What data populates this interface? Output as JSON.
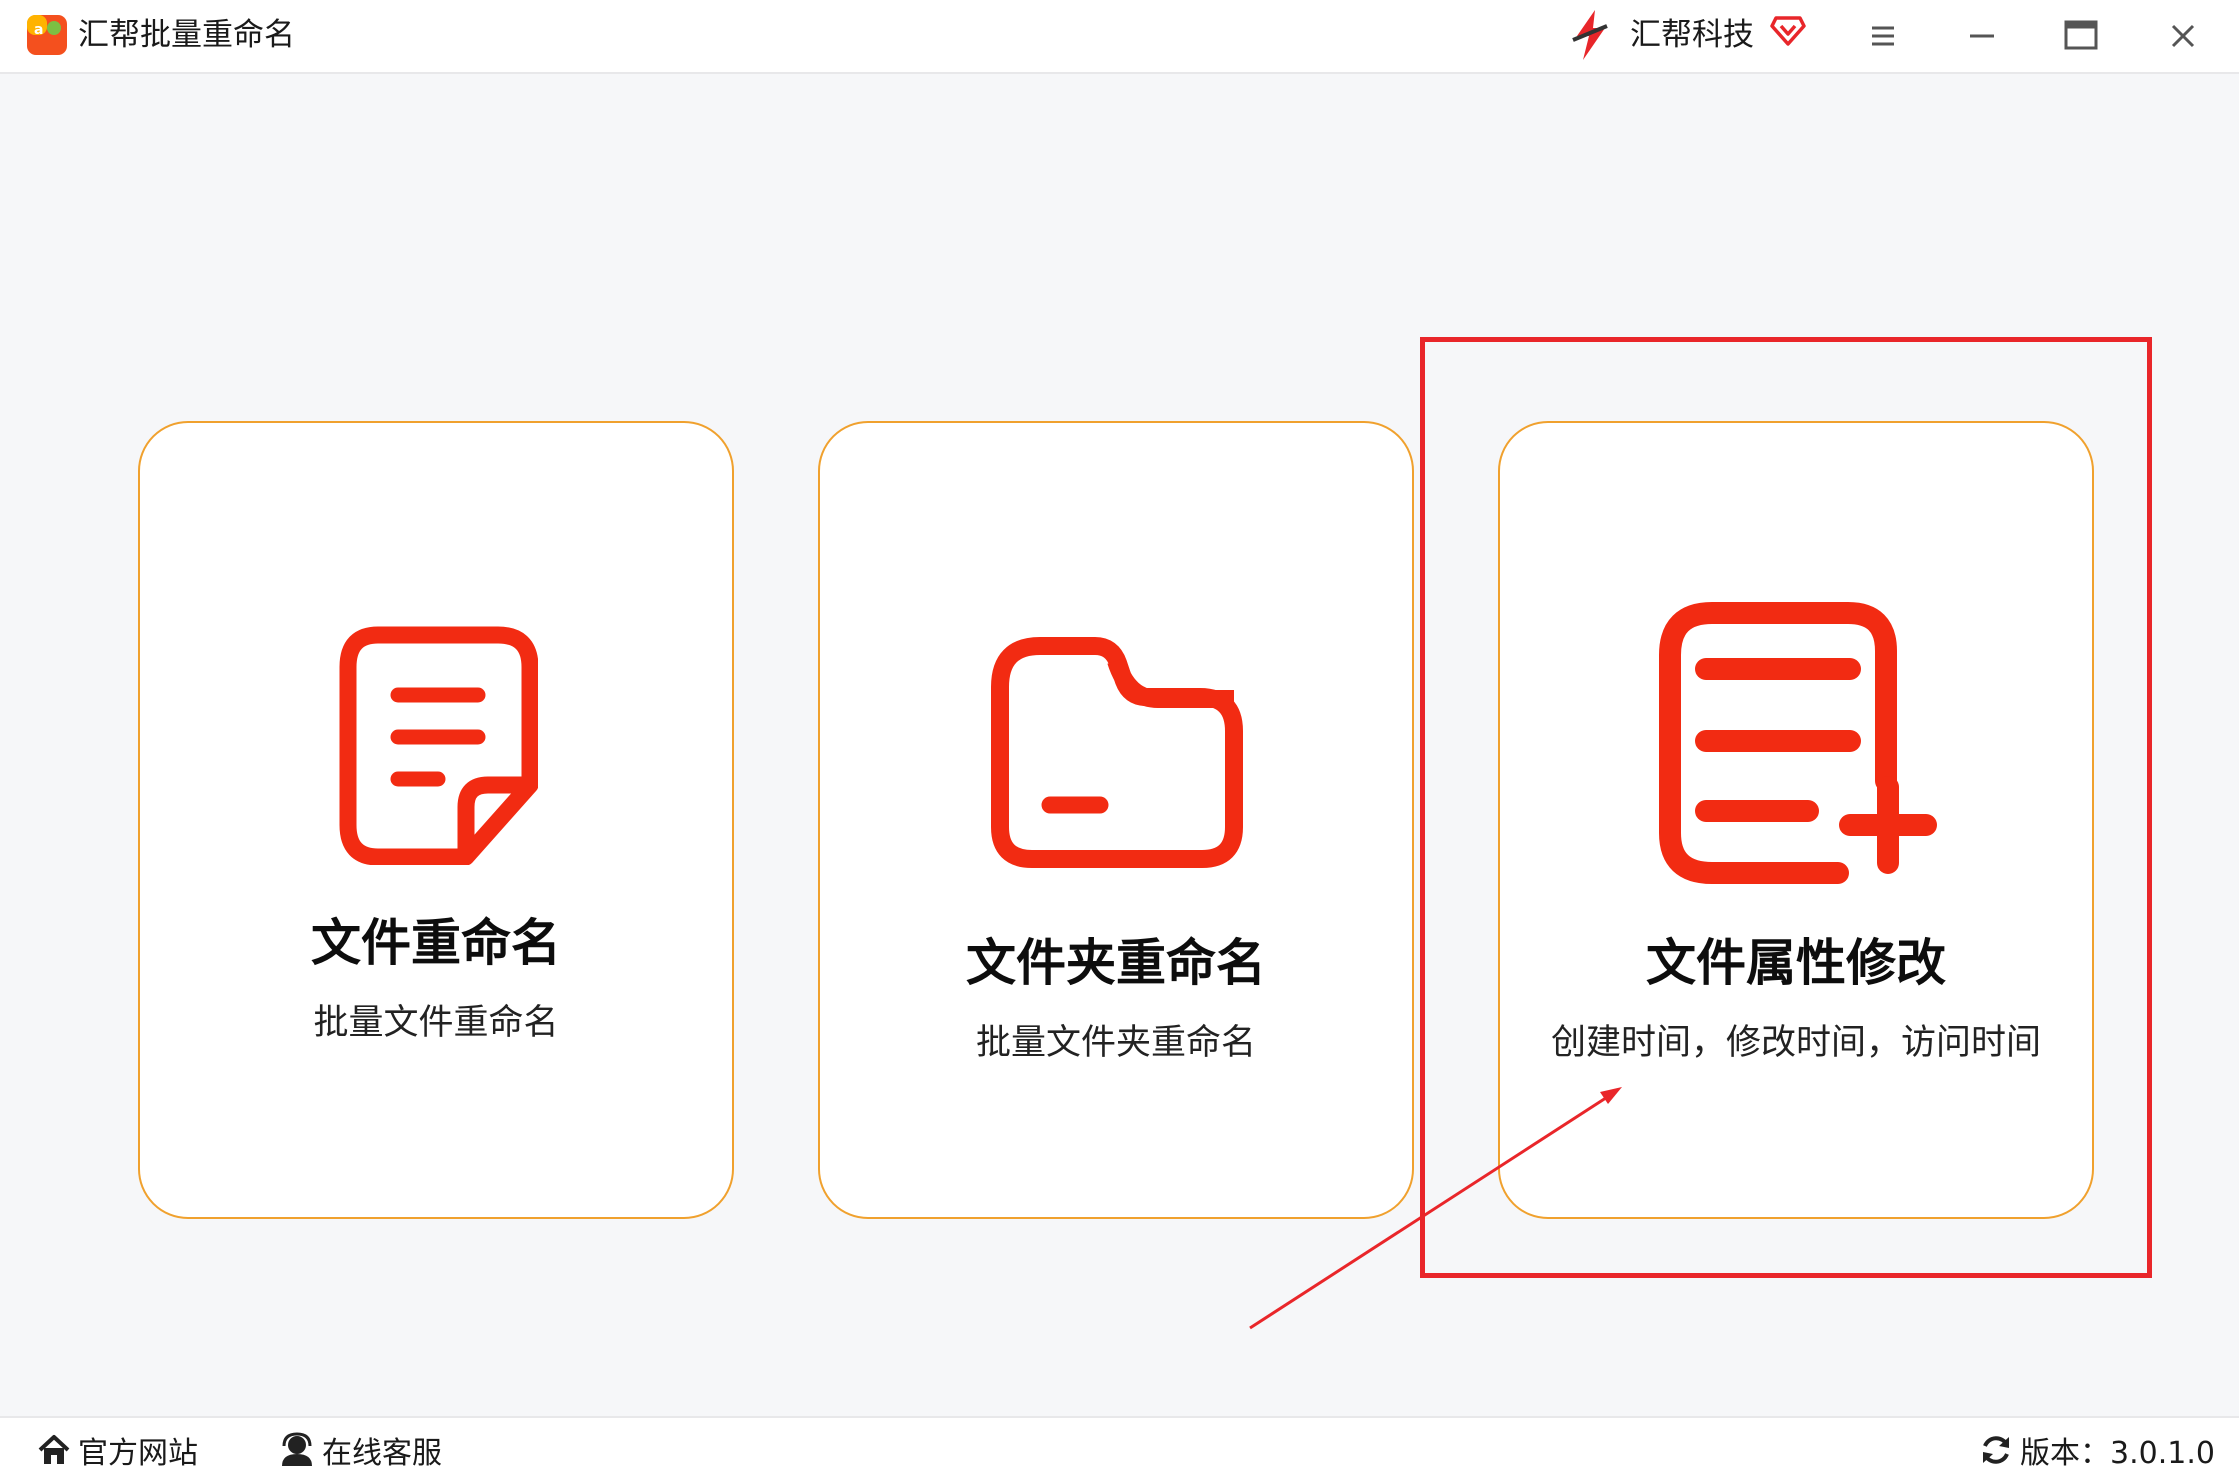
{
  "app": {
    "title": "汇帮批量重命名",
    "brand": "汇帮科技"
  },
  "accent": "#f22b12",
  "card_border": "#f0a12e",
  "highlight_color": "#e9262a",
  "cards": [
    {
      "title": "文件重命名",
      "subtitle": "批量文件重命名",
      "icon": "document-icon"
    },
    {
      "title": "文件夹重命名",
      "subtitle": "批量文件夹重命名",
      "icon": "folder-icon"
    },
    {
      "title": "文件属性修改",
      "subtitle": "创建时间，修改时间，访问时间",
      "icon": "document-add-icon"
    }
  ],
  "footer": {
    "official_site": "官方网站",
    "online_service": "在线客服",
    "version_label": "版本：3.0.1.0"
  }
}
